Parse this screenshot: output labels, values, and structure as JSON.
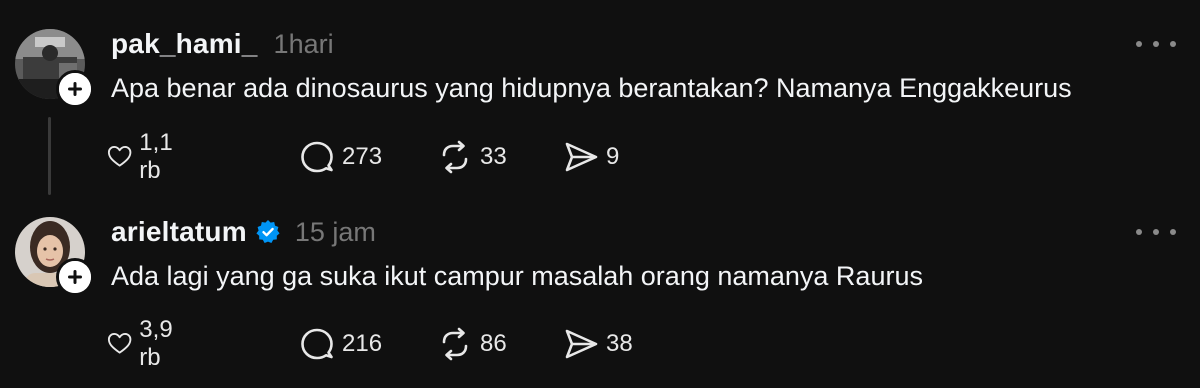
{
  "posts": [
    {
      "username": "pak_hami_",
      "time": "1hari",
      "verified": false,
      "text": "Apa benar ada dinosaurus yang hidupnya berantakan? Namanya Enggakkeurus",
      "likes": "1,1 rb",
      "replies": "273",
      "reposts": "33",
      "shares": "9"
    },
    {
      "username": "arieltatum",
      "time": "15 jam",
      "verified": true,
      "text": "Ada lagi yang ga suka ikut campur masalah orang namanya Raurus",
      "likes": "3,9 rb",
      "replies": "216",
      "reposts": "86",
      "shares": "38"
    }
  ],
  "icons": {
    "like": "heart-icon",
    "reply": "comment-icon",
    "repost": "repost-icon",
    "share": "send-icon",
    "more": "more-icon",
    "follow": "plus-icon",
    "verified": "verified-badge-icon"
  },
  "colors": {
    "background": "#101010",
    "text": "#f3f5f7",
    "muted": "#777777",
    "verified": "#0095f6"
  }
}
